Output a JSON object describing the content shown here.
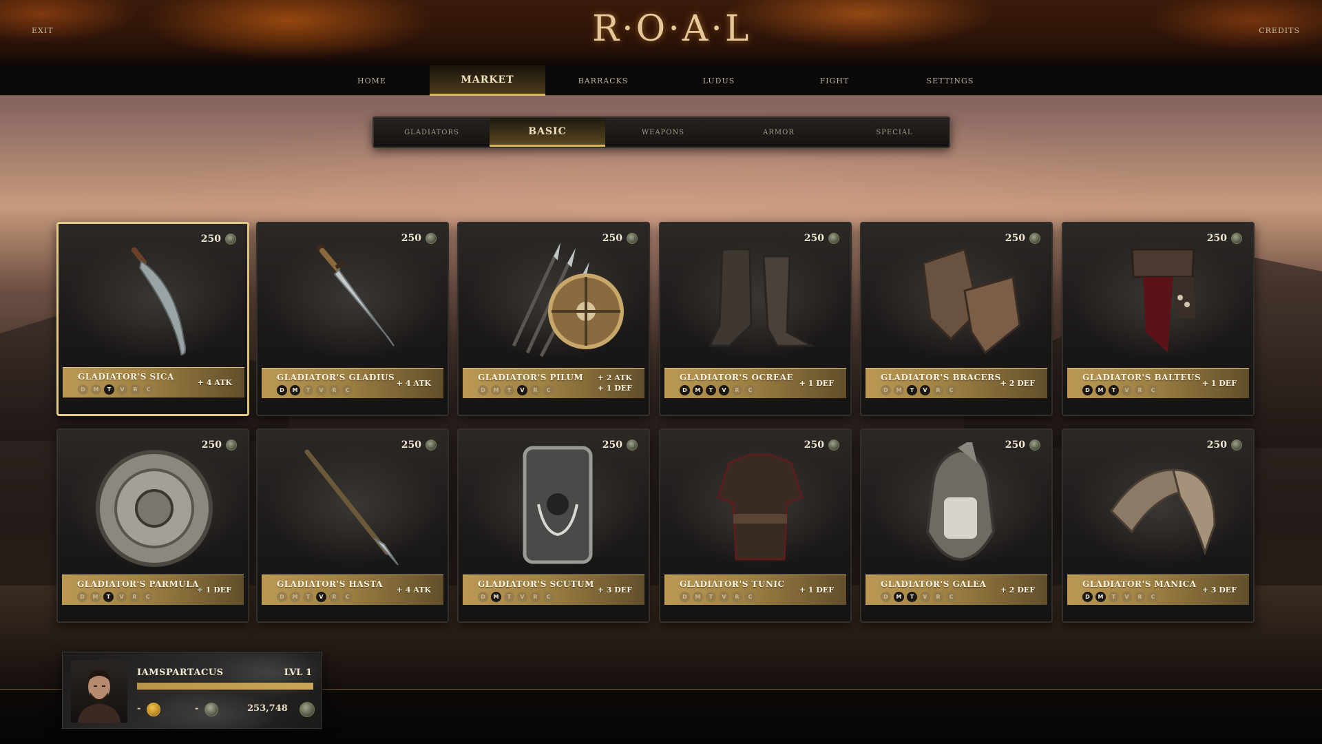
{
  "header": {
    "logo": "R·O·A·L",
    "exit_label": "EXIT",
    "credits_label": "CREDITS"
  },
  "nav": [
    {
      "label": "HOME",
      "active": false
    },
    {
      "label": "MARKET",
      "active": true
    },
    {
      "label": "BARRACKS",
      "active": false
    },
    {
      "label": "LUDUS",
      "active": false
    },
    {
      "label": "FIGHT",
      "active": false
    },
    {
      "label": "SETTINGS",
      "active": false
    }
  ],
  "subtabs": [
    {
      "label": "GLADIATORS",
      "active": false
    },
    {
      "label": "BASIC",
      "active": true
    },
    {
      "label": "WEAPONS",
      "active": false
    },
    {
      "label": "ARMOR",
      "active": false
    },
    {
      "label": "SPECIAL",
      "active": false
    }
  ],
  "class_letters": [
    "D",
    "M",
    "T",
    "V",
    "R",
    "C"
  ],
  "items": [
    {
      "name": "GLADIATOR'S SICA",
      "price": "250",
      "stats": [
        "+ 4 ATK"
      ],
      "classes": [
        false,
        false,
        true,
        false,
        false,
        false
      ],
      "icon": "sica-blade-icon",
      "selected": true
    },
    {
      "name": "GLADIATOR'S GLADIUS",
      "price": "250",
      "stats": [
        "+ 4 ATK"
      ],
      "classes": [
        true,
        true,
        false,
        false,
        false,
        false
      ],
      "icon": "gladius-sword-icon",
      "selected": false
    },
    {
      "name": "GLADIATOR'S PILUM",
      "price": "250",
      "stats": [
        "+ 2 ATK",
        "+ 1 DEF"
      ],
      "classes": [
        false,
        false,
        false,
        true,
        false,
        false
      ],
      "icon": "pilum-spears-shield-icon",
      "selected": false
    },
    {
      "name": "GLADIATOR'S OCREAE",
      "price": "250",
      "stats": [
        "+ 1 DEF"
      ],
      "classes": [
        true,
        true,
        true,
        true,
        false,
        false
      ],
      "icon": "ocreae-greaves-icon",
      "selected": false
    },
    {
      "name": "GLADIATOR'S BRACERS",
      "price": "250",
      "stats": [
        "+ 2 DEF"
      ],
      "classes": [
        false,
        false,
        true,
        true,
        false,
        false
      ],
      "icon": "bracers-icon",
      "selected": false
    },
    {
      "name": "GLADIATOR'S BALTEUS",
      "price": "250",
      "stats": [
        "+ 1 DEF"
      ],
      "classes": [
        true,
        true,
        true,
        false,
        false,
        false
      ],
      "icon": "balteus-belt-icon",
      "selected": false
    },
    {
      "name": "GLADIATOR'S PARMULA",
      "price": "250",
      "stats": [
        "+ 1 DEF"
      ],
      "classes": [
        false,
        false,
        true,
        false,
        false,
        false
      ],
      "icon": "parmula-round-shield-icon",
      "selected": false
    },
    {
      "name": "GLADIATOR'S HASTA",
      "price": "250",
      "stats": [
        "+ 4 ATK"
      ],
      "classes": [
        false,
        false,
        false,
        true,
        false,
        false
      ],
      "icon": "hasta-spear-icon",
      "selected": false
    },
    {
      "name": "GLADIATOR'S SCUTUM",
      "price": "250",
      "stats": [
        "+ 3 DEF"
      ],
      "classes": [
        false,
        true,
        false,
        false,
        false,
        false
      ],
      "icon": "scutum-shield-icon",
      "selected": false
    },
    {
      "name": "GLADIATOR'S TUNIC",
      "price": "250",
      "stats": [
        "+ 1 DEF"
      ],
      "classes": [
        false,
        false,
        false,
        false,
        false,
        false
      ],
      "icon": "tunic-icon",
      "selected": false
    },
    {
      "name": "GLADIATOR'S GALEA",
      "price": "250",
      "stats": [
        "+ 2 DEF"
      ],
      "classes": [
        false,
        true,
        true,
        false,
        false,
        false
      ],
      "icon": "galea-helmet-icon",
      "selected": false
    },
    {
      "name": "GLADIATOR'S MANICA",
      "price": "250",
      "stats": [
        "+ 3 DEF"
      ],
      "classes": [
        true,
        true,
        false,
        false,
        false,
        false
      ],
      "icon": "manica-armguard-icon",
      "selected": false
    }
  ],
  "player": {
    "name": "IAMSPARTACUS",
    "level": "LVL 1",
    "xp_fraction": 1.0,
    "gold": "-",
    "silver": "-",
    "balance": "253,748"
  }
}
